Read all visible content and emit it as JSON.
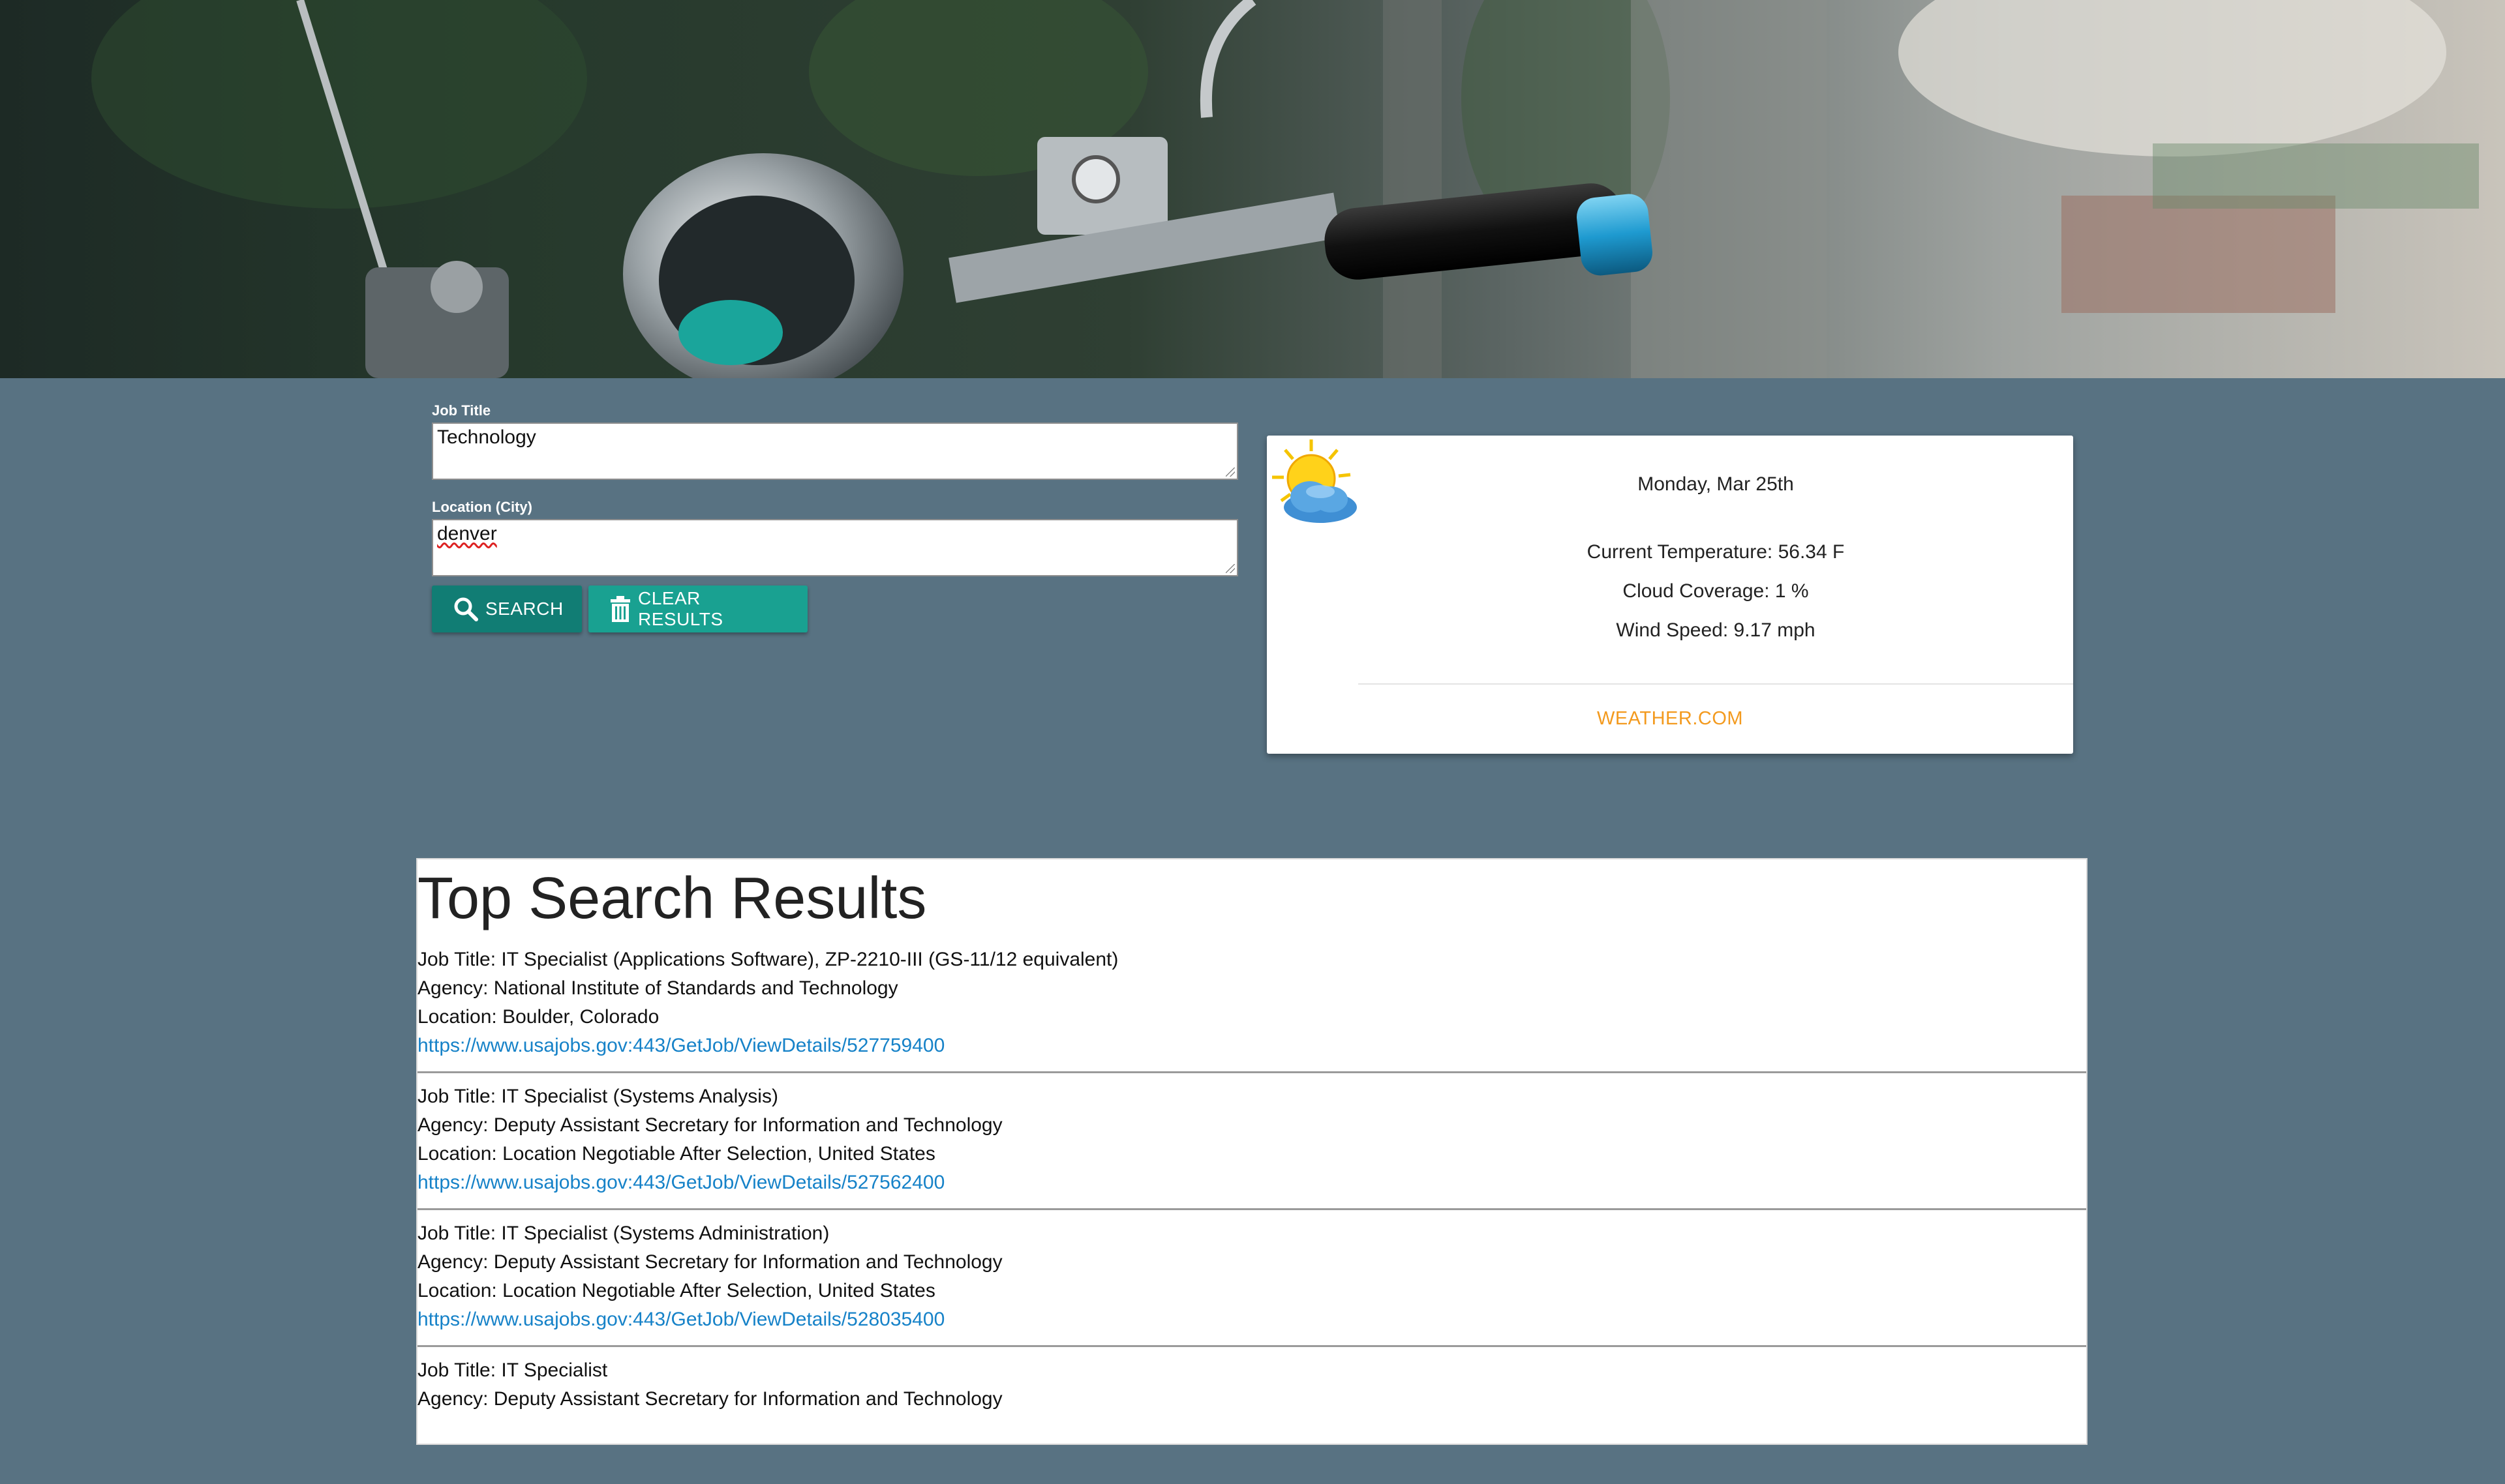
{
  "form": {
    "job_title_label": "Job Title",
    "job_title_value": "Technology",
    "location_label": "Location (City)",
    "location_value": "denver",
    "search_button": "SEARCH",
    "clear_button": "CLEAR RESULTS"
  },
  "weather": {
    "icon": "partly-cloudy-sun-icon",
    "date": "Monday, Mar 25th",
    "temperature": "Current Temperature: 56.34 F",
    "cloud_coverage": "Cloud Coverage: 1 %",
    "wind_speed": "Wind Speed: 9.17 mph",
    "link": "WEATHER.COM"
  },
  "results": {
    "heading": "Top Search Results",
    "items": [
      {
        "title": "Job Title: IT Specialist (Applications Software), ZP-2210-III (GS-11/12 equivalent)",
        "agency": "Agency: National Institute of Standards and Technology",
        "location": "Location: Boulder, Colorado",
        "url": "https://www.usajobs.gov:443/GetJob/ViewDetails/527759400"
      },
      {
        "title": "Job Title: IT Specialist (Systems Analysis)",
        "agency": "Agency: Deputy Assistant Secretary for Information and Technology",
        "location": "Location: Location Negotiable After Selection, United States",
        "url": "https://www.usajobs.gov:443/GetJob/ViewDetails/527562400"
      },
      {
        "title": "Job Title: IT Specialist (Systems Administration)",
        "agency": "Agency: Deputy Assistant Secretary for Information and Technology",
        "location": "Location: Location Negotiable After Selection, United States",
        "url": "https://www.usajobs.gov:443/GetJob/ViewDetails/528035400"
      },
      {
        "title": "Job Title: IT Specialist",
        "agency": "Agency: Deputy Assistant Secretary for Information and Technology"
      }
    ]
  },
  "colors": {
    "page_background": "#587282",
    "search_button": "#117d74",
    "clear_button": "#19a191",
    "weather_link": "#f39a1e",
    "result_link": "#1682c8"
  }
}
